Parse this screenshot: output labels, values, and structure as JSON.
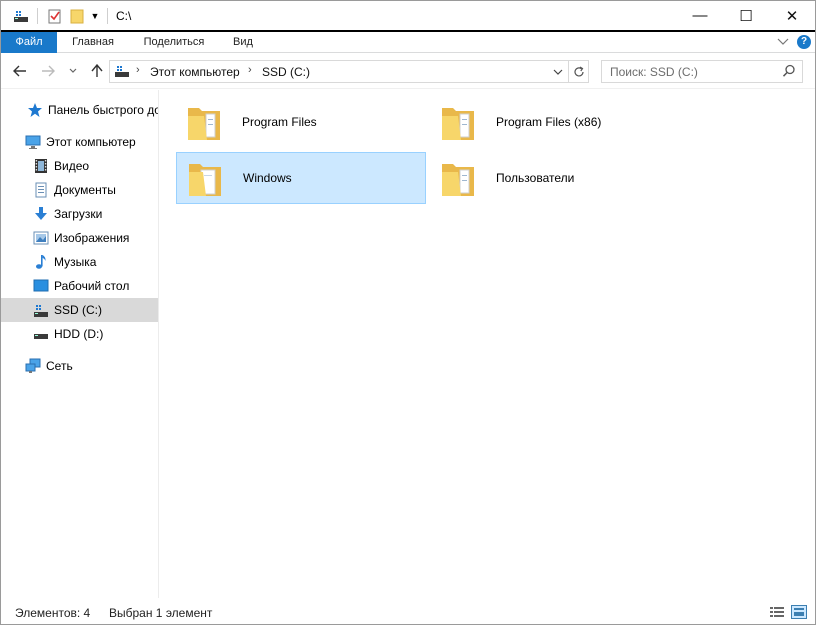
{
  "window": {
    "title": "C:\\",
    "controls": {
      "minimize": "—",
      "maximize": "☐",
      "close": "✕"
    }
  },
  "ribbon": {
    "tabs": [
      {
        "label": "Файл"
      },
      {
        "label": "Главная"
      },
      {
        "label": "Поделиться"
      },
      {
        "label": "Вид"
      }
    ],
    "help": "?"
  },
  "address": {
    "path": [
      "Этот компьютер",
      "SSD (C:)"
    ]
  },
  "search": {
    "placeholder": "Поиск: SSD (C:)"
  },
  "sidebar": {
    "items": [
      {
        "label": "Панель быстрого доступа",
        "icon": "star-icon"
      },
      {
        "label": "Этот компьютер",
        "icon": "computer-icon"
      },
      {
        "label": "Видео",
        "icon": "video-icon"
      },
      {
        "label": "Документы",
        "icon": "document-icon"
      },
      {
        "label": "Загрузки",
        "icon": "download-icon"
      },
      {
        "label": "Изображения",
        "icon": "image-icon"
      },
      {
        "label": "Музыка",
        "icon": "music-icon"
      },
      {
        "label": "Рабочий стол",
        "icon": "desktop-icon"
      },
      {
        "label": "SSD (C:)",
        "icon": "ssd-drive-icon",
        "selected": true
      },
      {
        "label": "HDD (D:)",
        "icon": "hdd-drive-icon"
      },
      {
        "label": "Сеть",
        "icon": "network-icon"
      }
    ]
  },
  "content": {
    "folders": [
      {
        "label": "Program Files",
        "selected": false
      },
      {
        "label": "Program Files (x86)",
        "selected": false
      },
      {
        "label": "Windows",
        "selected": true
      },
      {
        "label": "Пользователи",
        "selected": false
      }
    ]
  },
  "status": {
    "count": "Элементов: 4",
    "selection": "Выбран 1 элемент"
  },
  "colors": {
    "accent": "#1979ca",
    "selection_bg": "#cce8ff",
    "selection_border": "#99d1ff",
    "folder": "#f7d66a"
  }
}
